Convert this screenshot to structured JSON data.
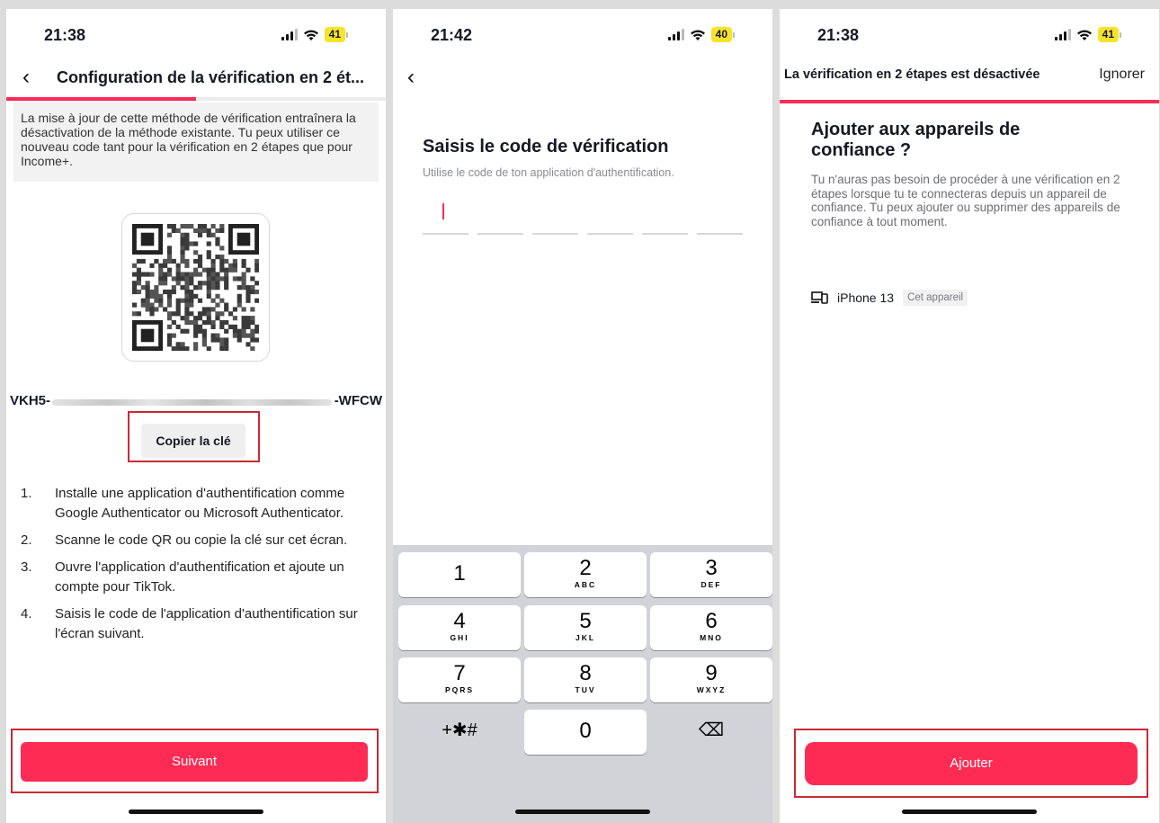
{
  "screens": [
    {
      "status": {
        "time": "21:38",
        "battery": "41"
      },
      "title": "Configuration de la vérification en 2 ét...",
      "progress": 0.5,
      "notice": "La mise à jour de cette méthode de vérification entraînera la désactivation de la méthode existante. Tu peux utiliser ce nouveau code tant pour la vérification en 2 étapes que pour Income+.",
      "key_prefix": "VKH5-",
      "key_suffix": "-WFCW",
      "copy_button": "Copier la clé",
      "steps": [
        {
          "num": "1.",
          "text": "Installe une application d'authentification comme Google Authenticator ou Microsoft Authenticator."
        },
        {
          "num": "2.",
          "text": "Scanne le code QR ou copie la clé sur cet écran."
        },
        {
          "num": "3.",
          "text": "Ouvre l'application d'authentification et ajoute un compte pour TikTok."
        },
        {
          "num": "4.",
          "text": "Saisis le code de l'application d'authentification sur l'écran suivant."
        }
      ],
      "next_button": "Suivant"
    },
    {
      "status": {
        "time": "21:42",
        "battery": "40"
      },
      "title": "Saisis le code de vérification",
      "subtitle": "Utilise le code de ton application d'authentification.",
      "code_length": 6,
      "keypad": [
        {
          "digit": "1",
          "letters": ""
        },
        {
          "digit": "2",
          "letters": "ABC"
        },
        {
          "digit": "3",
          "letters": "DEF"
        },
        {
          "digit": "4",
          "letters": "GHI"
        },
        {
          "digit": "5",
          "letters": "JKL"
        },
        {
          "digit": "6",
          "letters": "MNO"
        },
        {
          "digit": "7",
          "letters": "PQRS"
        },
        {
          "digit": "8",
          "letters": "TUV"
        },
        {
          "digit": "9",
          "letters": "WXYZ"
        },
        {
          "digit": "+✱#",
          "letters": ""
        },
        {
          "digit": "0",
          "letters": ""
        },
        {
          "digit": "⌫",
          "letters": ""
        }
      ]
    },
    {
      "status": {
        "time": "21:38",
        "battery": "41"
      },
      "topbar_title": "La vérification en 2 étapes est désactivée",
      "skip": "Ignorer",
      "heading": "Ajouter aux appareils de confiance ?",
      "description": "Tu n'auras pas besoin de procéder à une vérification en 2 étapes lorsque tu te connecteras depuis un appareil de confiance. Tu peux ajouter ou supprimer des appareils de confiance à tout moment.",
      "device_name": "iPhone 13",
      "device_tag": "Cet appareil",
      "add_button": "Ajouter"
    }
  ],
  "colors": {
    "accent": "#fe2c55",
    "highlight": "#c92a35"
  }
}
